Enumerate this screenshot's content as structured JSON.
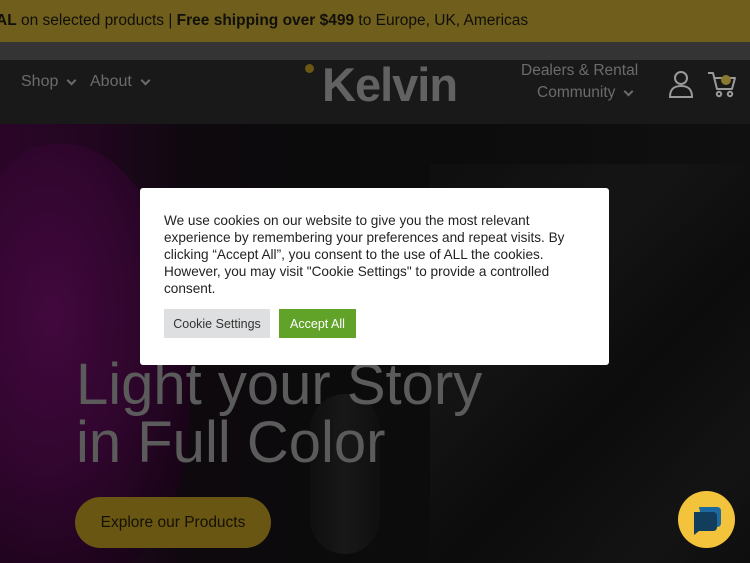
{
  "promo": {
    "lead": "AL",
    "text1": " on selected products | ",
    "bold": "Free shipping over $499",
    "text2": " to Europe, UK, Americas"
  },
  "nav": {
    "shop": "Shop",
    "about": "About",
    "logo": "Kelvin",
    "dealers": "Dealers & Rental",
    "community": "Community"
  },
  "hero": {
    "title_line1": "Light your Story",
    "title_line2": "in Full Color",
    "cta": "Explore our Products"
  },
  "cookie": {
    "message": "We use cookies on our website to give you the most relevant experience by remembering your preferences and repeat visits. By clicking “Accept All”, you consent to the use of ALL the cookies. However, you may visit \"Cookie Settings\" to provide a controlled consent.",
    "settings_label": "Cookie Settings",
    "accept_label": "Accept All"
  },
  "icons": {
    "account": "user-icon",
    "cart": "cart-icon",
    "chat": "chat-icon"
  },
  "colors": {
    "promo_bg": "#bfa231",
    "accent_gold": "#b5951f",
    "accept_green": "#61a229",
    "chat_yellow": "#f2c33b"
  }
}
